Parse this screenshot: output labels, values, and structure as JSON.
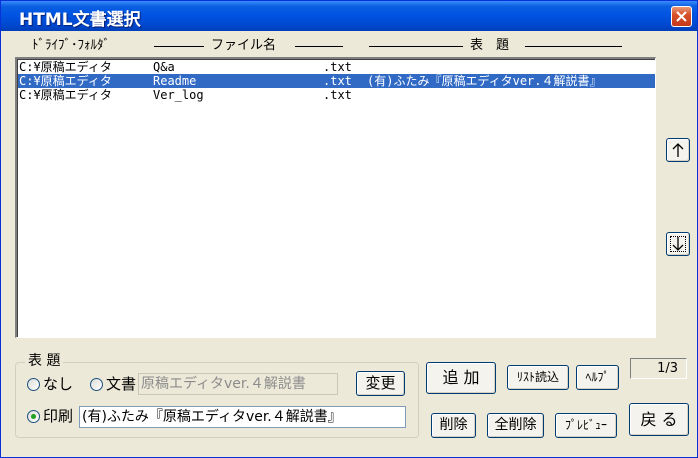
{
  "window": {
    "title": "HTML文書選択"
  },
  "columns": {
    "drive": "ﾄﾞﾗｲﾌﾞ･ﾌｫﾙﾀﾞ",
    "file": "ファイル名",
    "title": "表　題"
  },
  "rows": [
    {
      "drive": "C:¥原稿エディタ",
      "file": "Q&a",
      "ext": ".txt",
      "title": "",
      "selected": false
    },
    {
      "drive": "C:¥原稿エディタ",
      "file": "Readme",
      "ext": ".txt",
      "title": "(有)ふたみ『原稿エディタver.４解説書』",
      "selected": true
    },
    {
      "drive": "C:¥原稿エディタ",
      "file": "Ver_log",
      "ext": ".txt",
      "title": "",
      "selected": false
    }
  ],
  "buttons": {
    "up": "↑",
    "down": "↓",
    "change": "変更",
    "add": "追 加",
    "list_load": "ﾘｽﾄ読込",
    "help": "ﾍﾙﾌﾟ",
    "delete": "削除",
    "delete_all": "全削除",
    "preview": "ﾌﾟﾚﾋﾞｭｰ",
    "back": "戻 る"
  },
  "title_group": {
    "label": "表 題",
    "options": {
      "none": "なし",
      "document": "文書",
      "print": "印刷"
    },
    "selected": "print",
    "document_value": "原稿エディタver.４解説書",
    "print_value": "(有)ふたみ『原稿エディタver.４解説書』"
  },
  "counter": "1/3",
  "colors": {
    "selection": "#316ac5",
    "titlebar": "#0054e3",
    "face": "#ece9d8"
  }
}
